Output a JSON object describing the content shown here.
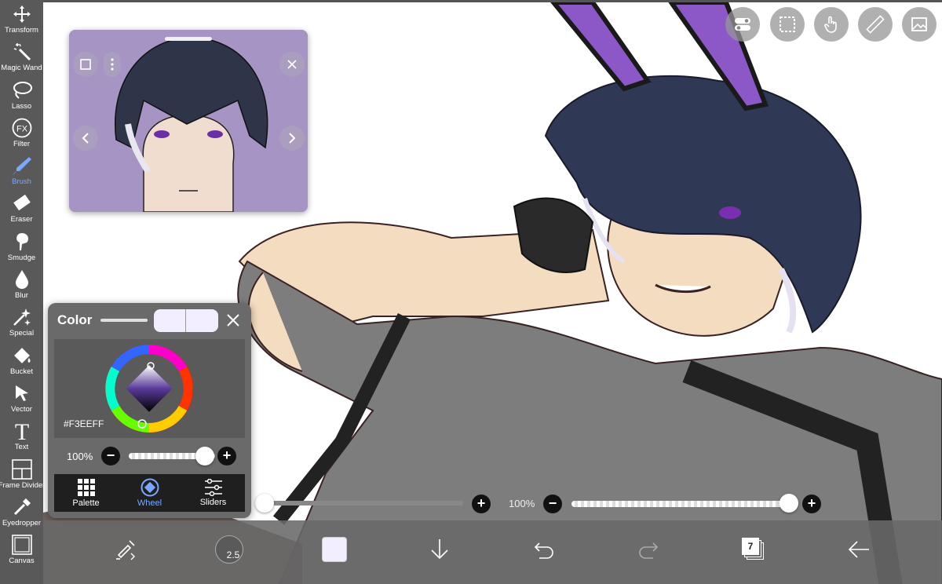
{
  "toolbar": {
    "items": [
      {
        "label": "Transform",
        "icon": "move-icon"
      },
      {
        "label": "Magic Wand",
        "icon": "magic-wand-icon"
      },
      {
        "label": "Lasso",
        "icon": "lasso-icon"
      },
      {
        "label": "Filter",
        "icon": "fx-icon"
      },
      {
        "label": "Brush",
        "icon": "brush-icon",
        "active": true
      },
      {
        "label": "Eraser",
        "icon": "eraser-icon"
      },
      {
        "label": "Smudge",
        "icon": "smudge-icon"
      },
      {
        "label": "Blur",
        "icon": "blur-drop-icon"
      },
      {
        "label": "Special",
        "icon": "sparkle-icon"
      },
      {
        "label": "Bucket",
        "icon": "bucket-icon"
      },
      {
        "label": "Vector",
        "icon": "cursor-icon"
      },
      {
        "label": "Text",
        "icon": "text-icon"
      },
      {
        "label": "Frame Divider",
        "icon": "frame-divider-icon"
      },
      {
        "label": "Eyedropper",
        "icon": "eyedropper-icon"
      },
      {
        "label": "Canvas",
        "icon": "canvas-icon"
      }
    ],
    "accent": "#7aa8ff"
  },
  "color_panel": {
    "title": "Color",
    "hex": "#F3EEFF",
    "opacity_label": "100%",
    "opacity_value": 100,
    "tabs": [
      {
        "label": "Palette"
      },
      {
        "label": "Wheel",
        "active": true
      },
      {
        "label": "Sliders"
      }
    ],
    "current_color": "#F3EEFF"
  },
  "brush_controls": {
    "size_plus": "+",
    "opacity_label": "100%",
    "opacity_minus": "−",
    "opacity_plus": "+"
  },
  "bottom_bar": {
    "brush_size": "2.5",
    "layer_count": "7"
  }
}
